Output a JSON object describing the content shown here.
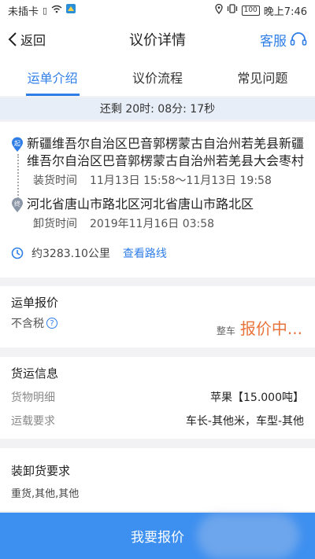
{
  "status_bar": {
    "carrier": "未插卡",
    "time": "晚上7:46",
    "battery": "100"
  },
  "header": {
    "back_label": "返回",
    "title": "议价详情",
    "service_label": "客服"
  },
  "tabs": [
    {
      "label": "运单介绍",
      "active": true
    },
    {
      "label": "议价流程",
      "active": false
    },
    {
      "label": "常见问题",
      "active": false
    }
  ],
  "countdown": "还剩 20时: 08分: 17秒",
  "route": {
    "start_badge": "起",
    "start_address": "新疆维吾尔自治区巴音郭楞蒙古自治州若羌县新疆维吾尔自治区巴音郭楞蒙古自治州若羌县大会枣村",
    "load_time_label": "装货时间",
    "load_time": "11月13日 15:58～11月13日 19:58",
    "end_badge": "终",
    "end_address": "河北省唐山市路北区河北省唐山市路北区",
    "unload_time_label": "卸货时间",
    "unload_time": "2019年11月16日 03:58",
    "distance": "约3283.10公里",
    "view_route_label": "查看路线"
  },
  "quote": {
    "title": "运单报价",
    "tax_label": "不含税",
    "help_mark": "?",
    "vehicle_type": "整车",
    "price": "报价中..."
  },
  "cargo": {
    "title": "货运信息",
    "goods_label": "货物明细",
    "goods_value": "苹果【15.000吨】",
    "requirement_label": "运载要求",
    "requirement_value": "车长-其他米，车型-其他"
  },
  "loading": {
    "title": "装卸货要求",
    "text": "重货,其他,其他"
  },
  "bottom_button": "我要报价",
  "colors": {
    "accent": "#2f7ee8",
    "price": "#e8743b",
    "button": "#3d8ff0"
  }
}
